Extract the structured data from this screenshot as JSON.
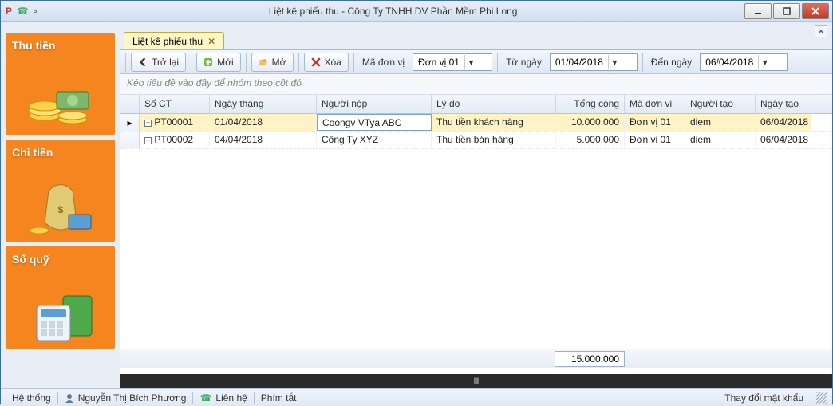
{
  "window_title": "Liệt kê phiếu thu - Công Ty TNHH DV Phần Mềm Phi Long",
  "sidebar": {
    "items": [
      {
        "label": "Thu tiền"
      },
      {
        "label": "Chi tiền"
      },
      {
        "label": "Sổ quỹ"
      }
    ]
  },
  "tab": {
    "label": "Liệt kê phiếu thu"
  },
  "toolbar": {
    "back": "Trở lại",
    "new": "Mới",
    "open": "Mở",
    "delete": "Xóa",
    "unit_label": "Mã đơn vị",
    "unit_value": "Đơn vị 01",
    "from_label": "Từ ngày",
    "from_value": "01/04/2018",
    "to_label": "Đến ngày",
    "to_value": "06/04/2018"
  },
  "group_hint": "Kéo tiêu đề vào đây để nhóm theo cột đó",
  "columns": {
    "soct": "Số CT",
    "ngaythang": "Ngày tháng",
    "nguoinop": "Người nộp",
    "lydo": "Lý do",
    "tongcong": "Tổng cộng",
    "madonvi": "Mã đơn vị",
    "nguoitao": "Người tạo",
    "ngaytao": "Ngày tạo"
  },
  "rows": [
    {
      "soct": "PT00001",
      "ngaythang": "01/04/2018",
      "nguoinop": "Coongv VTya ABC",
      "lydo": "Thu tiền khách hàng",
      "tongcong": "10.000.000",
      "madonvi": "Đơn vị 01",
      "nguoitao": "diem",
      "ngaytao": "06/04/2018"
    },
    {
      "soct": "PT00002",
      "ngaythang": "04/04/2018",
      "nguoinop": "Công Ty XYZ",
      "lydo": "Thu tiền bán hàng",
      "tongcong": "5.000.000",
      "madonvi": "Đơn vị 01",
      "nguoitao": "diem",
      "ngaytao": "06/04/2018"
    }
  ],
  "sum_total": "15.000.000",
  "statusbar": {
    "system": "Hệ thống",
    "user": "Nguyễn Thị Bích Phượng",
    "contact": "Liên hệ",
    "shortcuts": "Phím tắt",
    "change_pw": "Thay đổi mật khẩu"
  }
}
